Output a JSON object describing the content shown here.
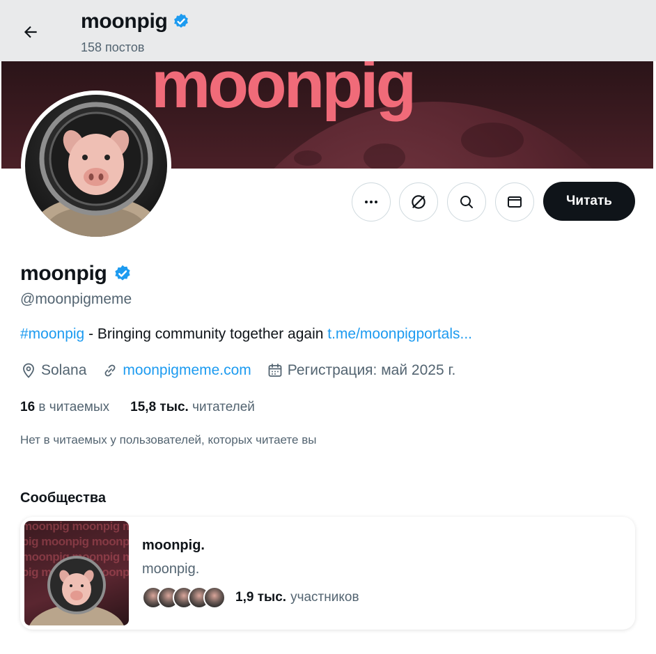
{
  "header": {
    "back_icon": "arrow-left-icon",
    "name": "moonpig",
    "posts": "158 постов"
  },
  "banner": {
    "title": "moonpig"
  },
  "actions": {
    "more_icon": "more-dots-icon",
    "grok_icon": "grok-icon",
    "search_icon": "search-icon",
    "message_icon": "envelope-icon",
    "follow_label": "Читать"
  },
  "profile": {
    "name": "moonpig",
    "handle": "@moonpigmeme",
    "bio_hashtag": "#moonpig",
    "bio_text": " - Bringing community together again ",
    "bio_link": "t.me/moonpigportals...",
    "location": "Solana",
    "website": "moonpigmeme.com",
    "joined": "Регистрация: май 2025 г.",
    "following_count": "16",
    "following_label": "в читаемых",
    "followers_count": "15,8 тыс.",
    "followers_label": "читателей",
    "mutual_note": "Нет в читаемых у пользователей, которых читаете вы"
  },
  "communities": {
    "title": "Сообщества",
    "card": {
      "name": "moonpig.",
      "subtitle": "moonpig.",
      "members_count": "1,9 тыс.",
      "members_label": "участников"
    }
  },
  "colors": {
    "accent": "#1d9bf0",
    "banner_text": "#f06b79",
    "follow_bg": "#0f1419"
  }
}
